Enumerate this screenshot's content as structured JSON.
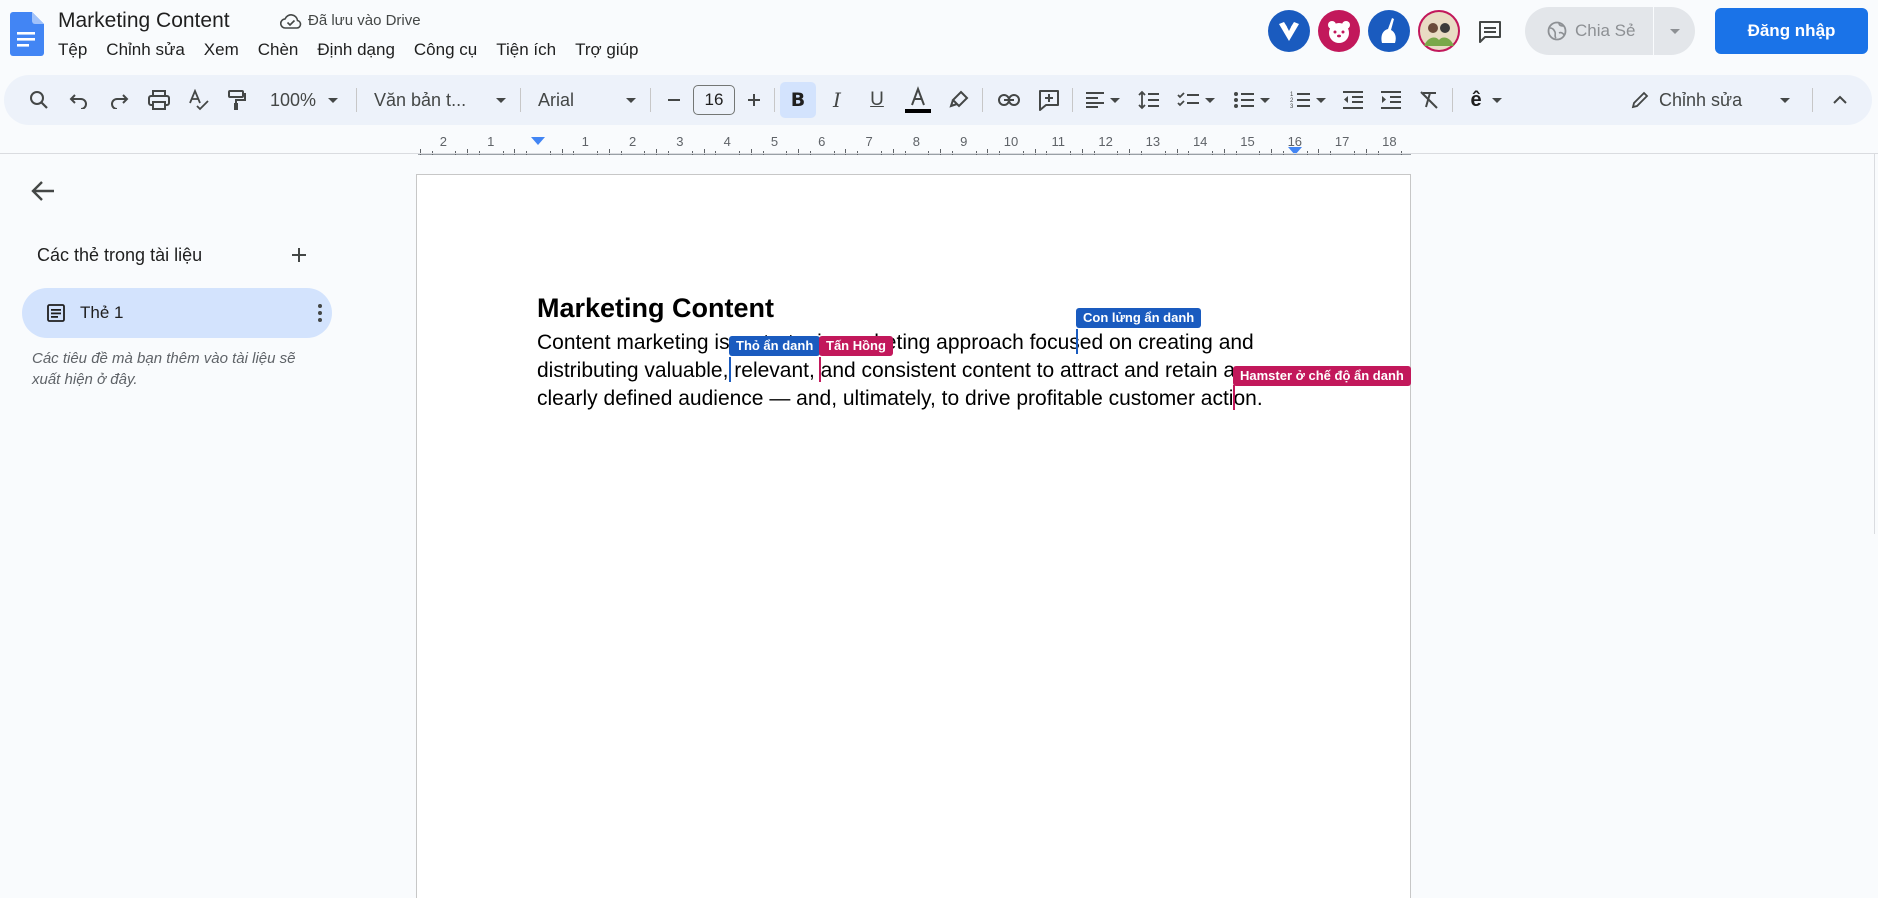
{
  "header": {
    "title": "Marketing Content",
    "save_status": "Đã lưu vào Drive",
    "menu": [
      "Tệp",
      "Chỉnh sửa",
      "Xem",
      "Chèn",
      "Định dạng",
      "Công cụ",
      "Tiện ích",
      "Trợ giúp"
    ],
    "share_label": "Chia Sẻ",
    "login_label": "Đăng nhập"
  },
  "toolbar": {
    "zoom": "100%",
    "style": "Văn bản t...",
    "font": "Arial",
    "font_size": "16",
    "edit_mode": "Chỉnh sửa"
  },
  "ruler": {
    "labels": [
      "2",
      "1",
      "1",
      "2",
      "3",
      "4",
      "5",
      "6",
      "7",
      "8",
      "9",
      "10",
      "11",
      "12",
      "13",
      "14",
      "15",
      "16",
      "17",
      "18"
    ]
  },
  "sidebar": {
    "heading": "Các thẻ trong tài liệu",
    "tab_label": "Thẻ 1",
    "hint": "Các tiêu đề mà bạn thêm vào tài liệu sẽ xuất hiện ở đây."
  },
  "document": {
    "heading": "Marketing Content",
    "lines": [
      "Content marketing is a strategic marketing approach focused on creating and",
      "distributing valuable, relevant, and consistent content to attract and retain a",
      "clearly defined audience — and, ultimately, to drive profitable customer action."
    ]
  },
  "collaborators": [
    {
      "name": "Thỏ ẩn danh",
      "color": "#1a5bbf"
    },
    {
      "name": "Tấn Hồng",
      "color": "#c2185b"
    },
    {
      "name": "Con lửng ẩn danh",
      "color": "#1a5bbf"
    },
    {
      "name": "Hamster ở chế độ ẩn danh",
      "color": "#c2185b"
    }
  ],
  "colors": {
    "accent": "#1a73e8",
    "tab_selected": "#d3e3fd",
    "toolbar_bg": "#edf2fa"
  }
}
